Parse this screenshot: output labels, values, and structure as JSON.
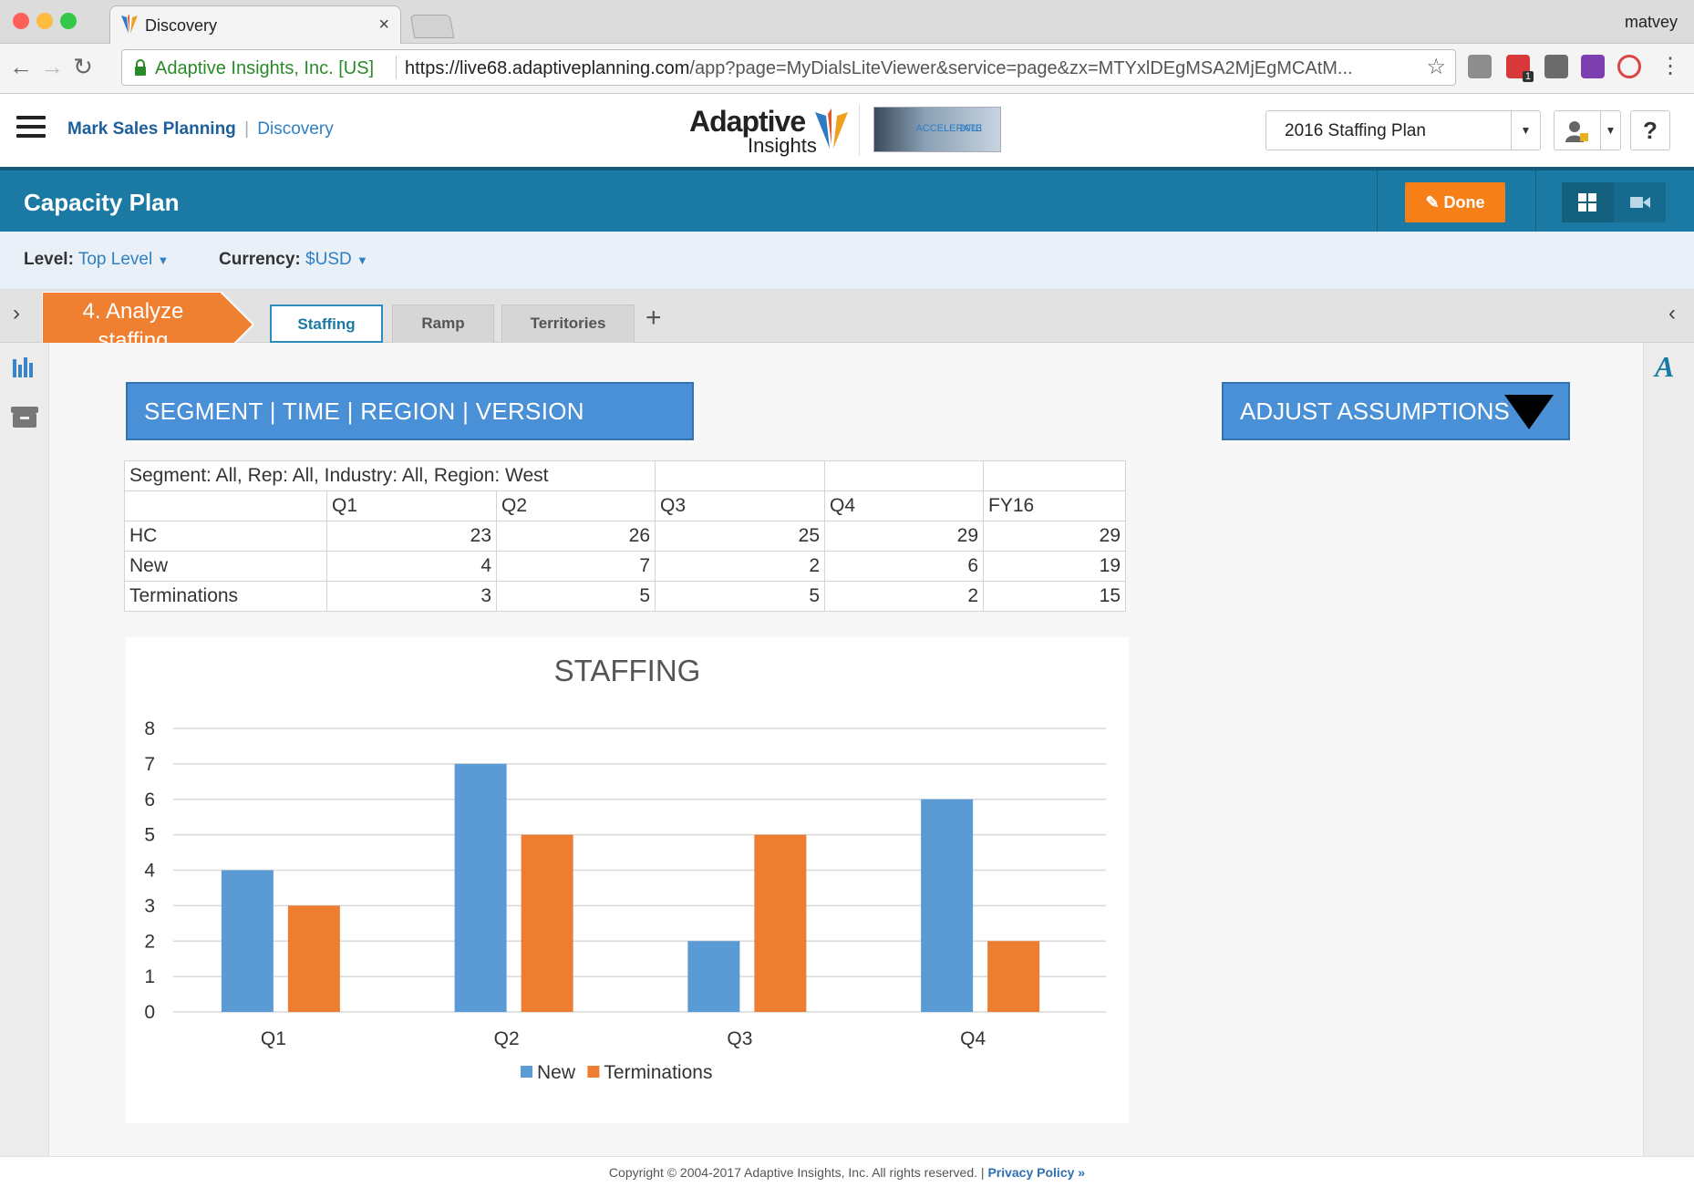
{
  "browser": {
    "tab_title": "Discovery",
    "tab_close": "×",
    "user": "matvey",
    "secure_label": "Adaptive Insights, Inc. [US]",
    "url_host": "https://live68.adaptiveplanning.com",
    "url_rest": "/app?page=MyDialsLiteViewer&service=page&zx=MTYxlDEgMSA2MjEgMCAtM...",
    "extension_badge": "1"
  },
  "header": {
    "org": "Mark Sales Planning",
    "separator": "|",
    "module": "Discovery",
    "logo_line1": "Adaptive",
    "logo_line2": "Insights",
    "banner_line1": "ACCELERATE",
    "banner_line2": "2013",
    "plan_selected": "2016 Staffing Plan",
    "help": "?"
  },
  "toolbar": {
    "page_title": "Capacity Plan",
    "done_label": "Done"
  },
  "filters": {
    "level_label": "Level:",
    "level_value": "Top Level",
    "currency_label": "Currency:",
    "currency_value": "$USD"
  },
  "tabs": {
    "step_line1": "4. Analyze",
    "step_line2": "staffing",
    "items": [
      "Staffing",
      "Ramp",
      "Territories"
    ],
    "add": "+"
  },
  "dimensions_bar": "SEGMENT | TIME | REGION | VERSION",
  "adjust_button": "ADJUST ASSUMPTIONS",
  "table": {
    "caption": "Segment: All, Rep: All, Industry: All, Region: West",
    "columns": [
      "",
      "Q1",
      "Q2",
      "Q3",
      "Q4",
      "FY16"
    ],
    "rows": [
      {
        "label": "HC",
        "values": [
          "23",
          "26",
          "25",
          "29",
          "29"
        ]
      },
      {
        "label": "New",
        "values": [
          "4",
          "7",
          "2",
          "6",
          "19"
        ]
      },
      {
        "label": "Terminations",
        "values": [
          "3",
          "5",
          "5",
          "2",
          "15"
        ]
      }
    ]
  },
  "chart_data": {
    "type": "bar",
    "title": "STAFFING",
    "categories": [
      "Q1",
      "Q2",
      "Q3",
      "Q4"
    ],
    "series": [
      {
        "name": "New",
        "values": [
          4,
          7,
          2,
          6
        ],
        "color": "#5b9bd5"
      },
      {
        "name": "Terminations",
        "values": [
          3,
          5,
          5,
          2
        ],
        "color": "#ed7d31"
      }
    ],
    "ylim": [
      0,
      8
    ],
    "yticks": [
      0,
      1,
      2,
      3,
      4,
      5,
      6,
      7,
      8
    ],
    "grid": true,
    "legend": "bottom"
  },
  "footer": {
    "copyright": "Copyright © 2004-2017 Adaptive Insights, Inc. All rights reserved.",
    "separator": "|",
    "privacy": "Privacy Policy »"
  }
}
